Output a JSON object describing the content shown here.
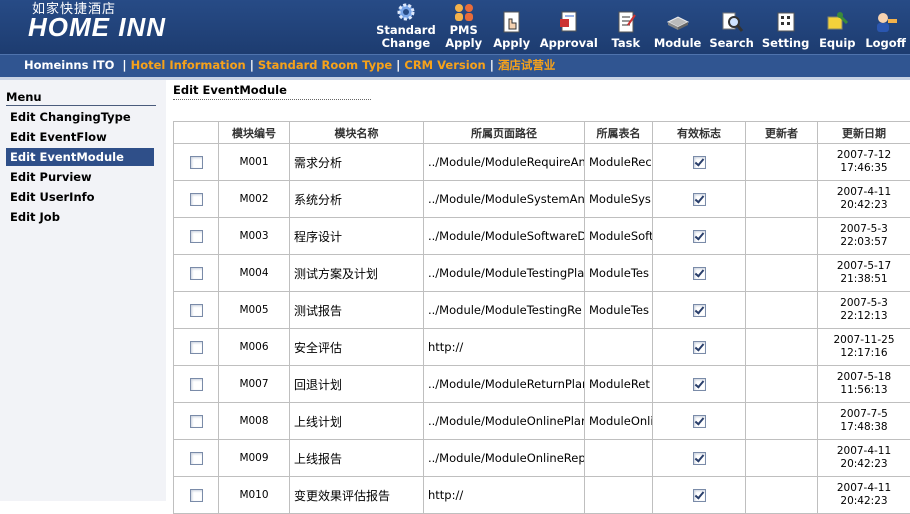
{
  "header": {
    "logo_cn": "如家快捷酒店",
    "logo_en": "HOME INN",
    "toolbar": [
      {
        "name": "standard-change-button",
        "icon": "gear-cog-icon",
        "label1": "Standard",
        "label2": "Change"
      },
      {
        "name": "pms-apply-button",
        "icon": "people-group-icon",
        "label1": "PMS",
        "label2": "Apply"
      },
      {
        "name": "apply-button",
        "icon": "pointer-hand-icon",
        "label1": "Apply",
        "label2": ""
      },
      {
        "name": "approval-button",
        "icon": "document-stamp-icon",
        "label1": "Approval",
        "label2": ""
      },
      {
        "name": "task-button",
        "icon": "checklist-icon",
        "label1": "Task",
        "label2": ""
      },
      {
        "name": "module-button",
        "icon": "module-chip-icon",
        "label1": "Module",
        "label2": ""
      },
      {
        "name": "search-button",
        "icon": "search-magnifier-icon",
        "label1": "Search",
        "label2": ""
      },
      {
        "name": "setting-button",
        "icon": "settings-icon",
        "label1": "Setting",
        "label2": ""
      },
      {
        "name": "equip-button",
        "icon": "equipment-icon",
        "label1": "Equip",
        "label2": ""
      },
      {
        "name": "logoff-button",
        "icon": "user-key-icon",
        "label1": "Logoff",
        "label2": ""
      }
    ]
  },
  "nav": {
    "home": "Homeinns ITO",
    "links": [
      "Hotel Information",
      "Standard Room Type",
      "CRM Version",
      "酒店试营业"
    ]
  },
  "sidebar": {
    "title": "Menu",
    "items": [
      {
        "label": "Edit ChangingType",
        "active": false
      },
      {
        "label": "Edit EventFlow",
        "active": false
      },
      {
        "label": "Edit EventModule",
        "active": true
      },
      {
        "label": "Edit Purview",
        "active": false
      },
      {
        "label": "Edit UserInfo",
        "active": false
      },
      {
        "label": "Edit Job",
        "active": false
      }
    ]
  },
  "main": {
    "title": "Edit EventModule",
    "columns": [
      "",
      "模块编号",
      "模块名称",
      "所属页面路径",
      "所属表名",
      "有效标志",
      "更新者",
      "更新日期"
    ],
    "rows": [
      {
        "code": "M001",
        "name": "需求分析",
        "path": "../Module/ModuleRequireAn",
        "table": "ModuleRec",
        "valid": true,
        "updater": "",
        "date1": "2007-7-12",
        "date2": "17:46:35"
      },
      {
        "code": "M002",
        "name": "系统分析",
        "path": "../Module/ModuleSystemAna",
        "table": "ModuleSys",
        "valid": true,
        "updater": "",
        "date1": "2007-4-11",
        "date2": "20:42:23"
      },
      {
        "code": "M003",
        "name": "程序设计",
        "path": "../Module/ModuleSoftwareD",
        "table": "ModuleSoft",
        "valid": true,
        "updater": "",
        "date1": "2007-5-3",
        "date2": "22:03:57"
      },
      {
        "code": "M004",
        "name": "测试方案及计划",
        "path": "../Module/ModuleTestingPla",
        "table": "ModuleTes",
        "valid": true,
        "updater": "",
        "date1": "2007-5-17",
        "date2": "21:38:51"
      },
      {
        "code": "M005",
        "name": "测试报告",
        "path": "../Module/ModuleTestingRe",
        "table": "ModuleTes",
        "valid": true,
        "updater": "",
        "date1": "2007-5-3",
        "date2": "22:12:13"
      },
      {
        "code": "M006",
        "name": "安全评估",
        "path": "http://",
        "table": "",
        "valid": true,
        "updater": "",
        "date1": "2007-11-25",
        "date2": "12:17:16"
      },
      {
        "code": "M007",
        "name": "回退计划",
        "path": "../Module/ModuleReturnPlar",
        "table": "ModuleRet",
        "valid": true,
        "updater": "",
        "date1": "2007-5-18",
        "date2": "11:56:13"
      },
      {
        "code": "M008",
        "name": "上线计划",
        "path": "../Module/ModuleOnlinePlar",
        "table": "ModuleOnli",
        "valid": true,
        "updater": "",
        "date1": "2007-7-5",
        "date2": "17:48:38"
      },
      {
        "code": "M009",
        "name": "上线报告",
        "path": "../Module/ModuleOnlineRep",
        "table": "",
        "valid": true,
        "updater": "",
        "date1": "2007-4-11",
        "date2": "20:42:23"
      },
      {
        "code": "M010",
        "name": "变更效果评估报告",
        "path": "http://",
        "table": "",
        "valid": true,
        "updater": "",
        "date1": "2007-4-11",
        "date2": "20:42:23"
      }
    ]
  }
}
